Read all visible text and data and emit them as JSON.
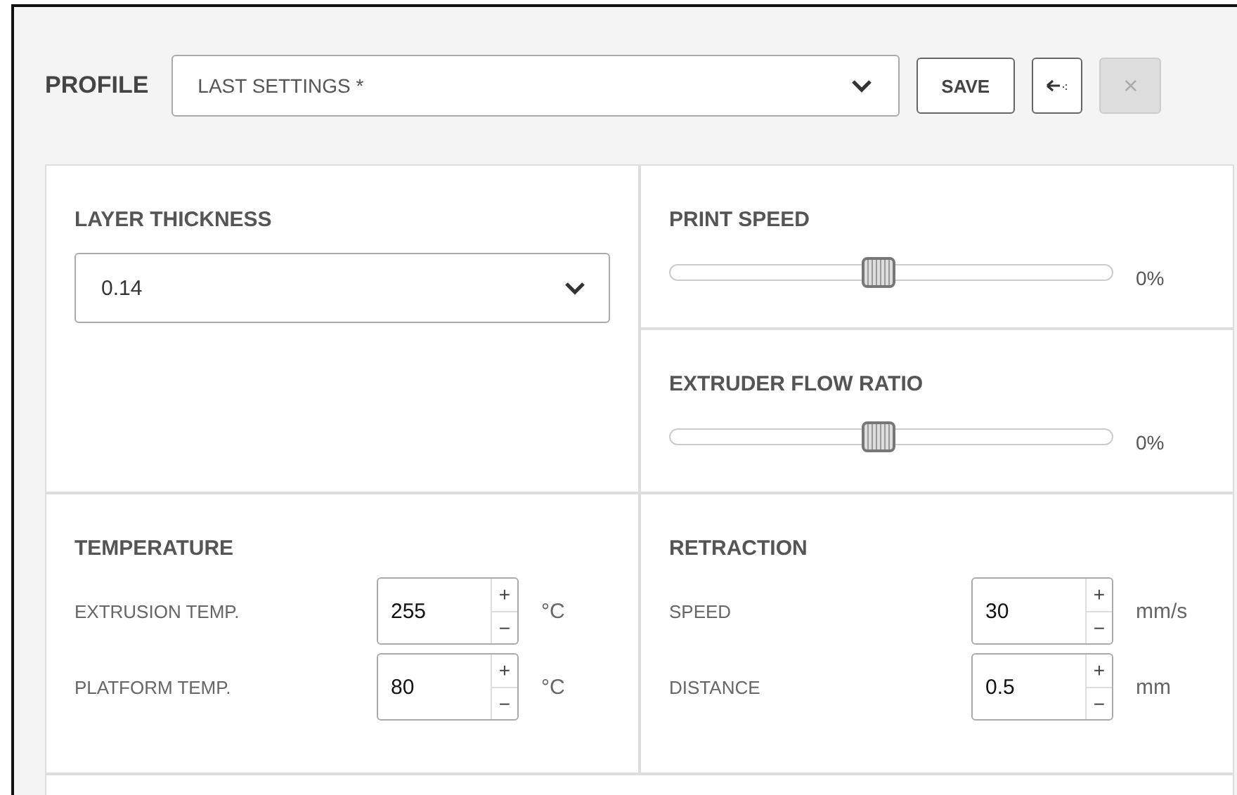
{
  "profile": {
    "label": "PROFILE",
    "value": "LAST SETTINGS *",
    "save": "SAVE",
    "close": "×",
    "close_disabled": true
  },
  "layer": {
    "title": "LAYER THICKNESS",
    "value": "0.14"
  },
  "sliders": [
    {
      "title": "PRINT SPEED",
      "level": 0.47,
      "reading": "0%"
    },
    {
      "title": "EXTRUDER FLOW RATIO",
      "level": 0.47,
      "reading": "0%"
    }
  ],
  "groups": [
    {
      "title": "TEMPERATURE",
      "fields": [
        {
          "label": "EXTRUSION TEMP.",
          "value": "255",
          "plus": "+",
          "minus": "−",
          "unit": "°C"
        },
        {
          "label": "PLATFORM TEMP.",
          "value": "80",
          "plus": "+",
          "minus": "−",
          "unit": "°C"
        }
      ]
    },
    {
      "title": "RETRACTION",
      "fields": [
        {
          "label": "SPEED",
          "value": "30",
          "plus": "+",
          "minus": "−",
          "unit": "mm/s"
        },
        {
          "label": "DISTANCE",
          "value": "0.5",
          "plus": "+",
          "minus": "−",
          "unit": "mm"
        }
      ]
    }
  ]
}
